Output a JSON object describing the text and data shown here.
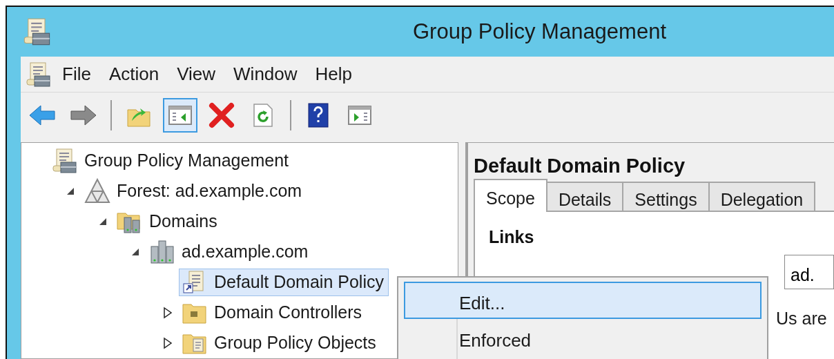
{
  "window": {
    "title": "Group Policy Management"
  },
  "menu_bar": [
    "File",
    "Action",
    "View",
    "Window",
    "Help"
  ],
  "toolbar": [
    [
      {
        "kind": "back",
        "pressed": false
      },
      {
        "kind": "forward",
        "pressed": false
      }
    ],
    [
      {
        "kind": "up",
        "pressed": false
      },
      {
        "kind": "tree",
        "pressed": true
      },
      {
        "kind": "delete",
        "pressed": false
      },
      {
        "kind": "refresh",
        "pressed": false
      }
    ],
    [
      {
        "kind": "help",
        "pressed": false
      },
      {
        "kind": "actionpane",
        "pressed": false
      }
    ]
  ],
  "tree": [
    {
      "label": "Group Policy Management",
      "kind": "console",
      "selected": false,
      "children": [
        {
          "label": "Forest: ad.example.com",
          "kind": "forest",
          "expanded": true,
          "selected": false,
          "children": [
            {
              "label": "Domains",
              "kind": "domains",
              "expanded": true,
              "selected": false,
              "children": [
                {
                  "label": "ad.example.com",
                  "kind": "domain",
                  "expanded": true,
                  "selected": false,
                  "children": [
                    {
                      "label": "Default Domain Policy",
                      "kind": "gpo",
                      "selected": true
                    },
                    {
                      "label": "Domain Controllers",
                      "kind": "ou",
                      "expanded": false,
                      "selected": false
                    },
                    {
                      "label": "Group Policy Objects",
                      "kind": "gpofolder",
                      "expanded": false,
                      "selected": false
                    }
                  ]
                }
              ]
            }
          ]
        }
      ]
    }
  ],
  "details": {
    "title": "Default Domain Policy",
    "tabs": [
      {
        "label": "Scope",
        "selected": true
      },
      {
        "label": "Details",
        "selected": false
      },
      {
        "label": "Settings",
        "selected": false
      },
      {
        "label": "Delegation",
        "selected": false
      }
    ],
    "section": "Links",
    "location_value": "ad.",
    "note": "Us are"
  },
  "context_menu": [
    {
      "label": "Edit...",
      "selected": true
    },
    {
      "label": "Enforced",
      "selected": false
    }
  ]
}
